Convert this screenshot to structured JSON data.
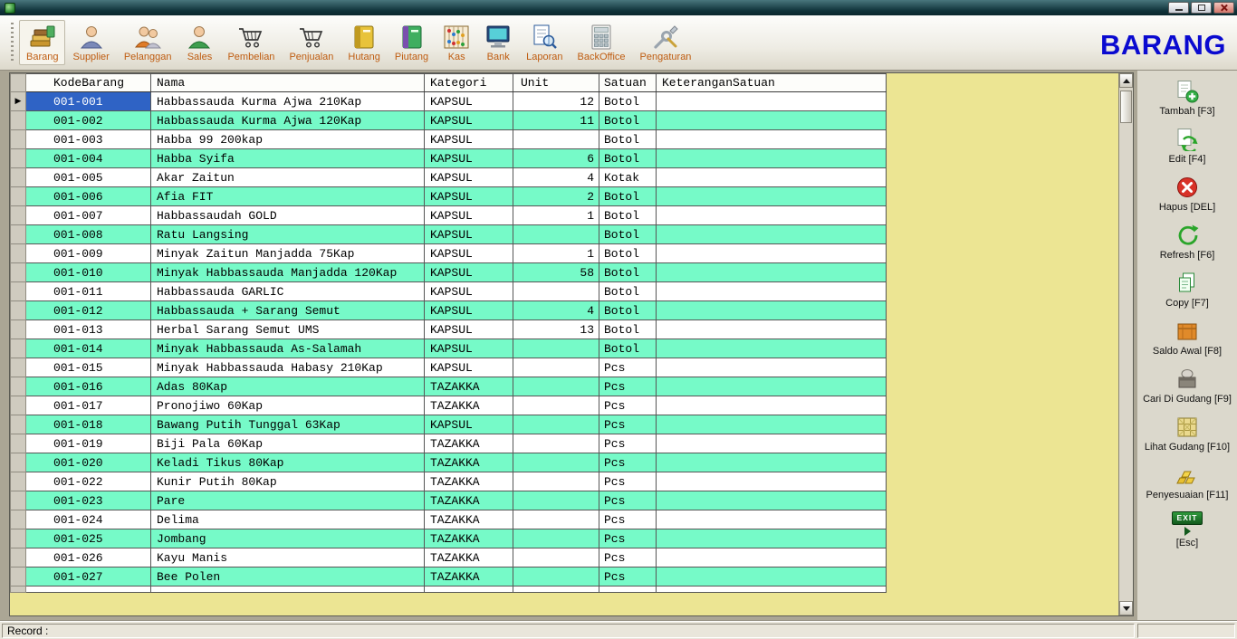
{
  "window": {
    "name": "inventory-application"
  },
  "header": {
    "brand": "BARANG"
  },
  "toolbar": {
    "items": [
      {
        "label": "Barang",
        "icon": "barang-icon"
      },
      {
        "label": "Supplier",
        "icon": "supplier-icon"
      },
      {
        "label": "Pelanggan",
        "icon": "pelanggan-icon"
      },
      {
        "label": "Sales",
        "icon": "sales-icon"
      },
      {
        "label": "Pembelian",
        "icon": "pembelian-cart-icon"
      },
      {
        "label": "Penjualan",
        "icon": "penjualan-cart-icon"
      },
      {
        "label": "Hutang",
        "icon": "hutang-book-icon"
      },
      {
        "label": "Piutang",
        "icon": "piutang-book-icon"
      },
      {
        "label": "Kas",
        "icon": "kas-abacus-icon"
      },
      {
        "label": "Bank",
        "icon": "bank-monitor-icon"
      },
      {
        "label": "Laporan",
        "icon": "laporan-report-icon"
      },
      {
        "label": "BackOffice",
        "icon": "backoffice-calculator-icon"
      },
      {
        "label": "Pengaturan",
        "icon": "pengaturan-tools-icon"
      }
    ]
  },
  "grid": {
    "columns": [
      "KodeBarang",
      "Nama",
      "Kategori",
      "Unit",
      "Satuan",
      "KeteranganSatuan"
    ],
    "rows": [
      {
        "pointer": "▶",
        "kode": "001-001",
        "nama": "Habbassauda Kurma Ajwa 210Kap",
        "kategori": "KAPSUL",
        "unit": "12",
        "satuan": "Botol",
        "keterangan": ""
      },
      {
        "pointer": "",
        "kode": "001-002",
        "nama": "Habbassauda Kurma Ajwa 120Kap",
        "kategori": "KAPSUL",
        "unit": "11",
        "satuan": "Botol",
        "keterangan": ""
      },
      {
        "pointer": "",
        "kode": "001-003",
        "nama": "Habba 99 200kap",
        "kategori": "KAPSUL",
        "unit": "",
        "satuan": "Botol",
        "keterangan": ""
      },
      {
        "pointer": "",
        "kode": "001-004",
        "nama": "Habba Syifa",
        "kategori": "KAPSUL",
        "unit": "6",
        "satuan": "Botol",
        "keterangan": ""
      },
      {
        "pointer": "",
        "kode": "001-005",
        "nama": "Akar Zaitun",
        "kategori": "KAPSUL",
        "unit": "4",
        "satuan": "Kotak",
        "keterangan": ""
      },
      {
        "pointer": "",
        "kode": "001-006",
        "nama": "Afia FIT",
        "kategori": "KAPSUL",
        "unit": "2",
        "satuan": "Botol",
        "keterangan": ""
      },
      {
        "pointer": "",
        "kode": "001-007",
        "nama": "Habbassaudah GOLD",
        "kategori": "KAPSUL",
        "unit": "1",
        "satuan": "Botol",
        "keterangan": ""
      },
      {
        "pointer": "",
        "kode": "001-008",
        "nama": "Ratu Langsing",
        "kategori": "KAPSUL",
        "unit": "",
        "satuan": "Botol",
        "keterangan": ""
      },
      {
        "pointer": "",
        "kode": "001-009",
        "nama": "Minyak Zaitun Manjadda 75Kap",
        "kategori": "KAPSUL",
        "unit": "1",
        "satuan": "Botol",
        "keterangan": ""
      },
      {
        "pointer": "",
        "kode": "001-010",
        "nama": "Minyak Habbassauda Manjadda 120Kap",
        "kategori": "KAPSUL",
        "unit": "58",
        "satuan": "Botol",
        "keterangan": ""
      },
      {
        "pointer": "",
        "kode": "001-011",
        "nama": "Habbassauda GARLIC",
        "kategori": "KAPSUL",
        "unit": "",
        "satuan": "Botol",
        "keterangan": ""
      },
      {
        "pointer": "",
        "kode": "001-012",
        "nama": "Habbassauda + Sarang Semut",
        "kategori": "KAPSUL",
        "unit": "4",
        "satuan": "Botol",
        "keterangan": ""
      },
      {
        "pointer": "",
        "kode": "001-013",
        "nama": "Herbal Sarang Semut UMS",
        "kategori": "KAPSUL",
        "unit": "13",
        "satuan": "Botol",
        "keterangan": ""
      },
      {
        "pointer": "",
        "kode": "001-014",
        "nama": "Minyak Habbassauda As-Salamah",
        "kategori": "KAPSUL",
        "unit": "",
        "satuan": "Botol",
        "keterangan": ""
      },
      {
        "pointer": "",
        "kode": "001-015",
        "nama": "Minyak Habbassauda Habasy 210Kap",
        "kategori": "KAPSUL",
        "unit": "",
        "satuan": "Pcs",
        "keterangan": ""
      },
      {
        "pointer": "",
        "kode": "001-016",
        "nama": "Adas 80Kap",
        "kategori": "TAZAKKA",
        "unit": "",
        "satuan": "Pcs",
        "keterangan": ""
      },
      {
        "pointer": "",
        "kode": "001-017",
        "nama": "Pronojiwo 60Kap",
        "kategori": "TAZAKKA",
        "unit": "",
        "satuan": "Pcs",
        "keterangan": ""
      },
      {
        "pointer": "",
        "kode": "001-018",
        "nama": "Bawang Putih Tunggal 63Kap",
        "kategori": "KAPSUL",
        "unit": "",
        "satuan": "Pcs",
        "keterangan": ""
      },
      {
        "pointer": "",
        "kode": "001-019",
        "nama": "Biji Pala 60Kap",
        "kategori": "TAZAKKA",
        "unit": "",
        "satuan": "Pcs",
        "keterangan": ""
      },
      {
        "pointer": "",
        "kode": "001-020",
        "nama": "Keladi Tikus 80Kap",
        "kategori": "TAZAKKA",
        "unit": "",
        "satuan": "Pcs",
        "keterangan": ""
      },
      {
        "pointer": "",
        "kode": "001-022",
        "nama": "Kunir Putih 80Kap",
        "kategori": "TAZAKKA",
        "unit": "",
        "satuan": "Pcs",
        "keterangan": ""
      },
      {
        "pointer": "",
        "kode": "001-023",
        "nama": "Pare",
        "kategori": "TAZAKKA",
        "unit": "",
        "satuan": "Pcs",
        "keterangan": ""
      },
      {
        "pointer": "",
        "kode": "001-024",
        "nama": "Delima",
        "kategori": "TAZAKKA",
        "unit": "",
        "satuan": "Pcs",
        "keterangan": ""
      },
      {
        "pointer": "",
        "kode": "001-025",
        "nama": "Jombang",
        "kategori": "TAZAKKA",
        "unit": "",
        "satuan": "Pcs",
        "keterangan": ""
      },
      {
        "pointer": "",
        "kode": "001-026",
        "nama": "Kayu Manis",
        "kategori": "TAZAKKA",
        "unit": "",
        "satuan": "Pcs",
        "keterangan": ""
      },
      {
        "pointer": "",
        "kode": "001-027",
        "nama": "Bee Polen",
        "kategori": "TAZAKKA",
        "unit": "",
        "satuan": "Pcs",
        "keterangan": ""
      }
    ]
  },
  "sidebar": {
    "buttons": [
      {
        "label": "Tambah [F3]",
        "icon": "tambah-add-icon"
      },
      {
        "label": "Edit [F4]",
        "icon": "edit-icon"
      },
      {
        "label": "Hapus [DEL]",
        "icon": "hapus-delete-icon"
      },
      {
        "label": "Refresh [F6]",
        "icon": "refresh-icon"
      },
      {
        "label": "Copy [F7]",
        "icon": "copy-icon"
      },
      {
        "label": "Saldo Awal [F8]",
        "icon": "saldo-awal-crate-icon"
      },
      {
        "label": "Cari Di Gudang [F9]",
        "icon": "cari-gudang-icon"
      },
      {
        "label": "Lihat Gudang [F10]",
        "icon": "lihat-gudang-icon"
      },
      {
        "label": "Penyesuaian [F11]",
        "icon": "penyesuaian-gold-icon"
      },
      {
        "label": "[Esc]",
        "icon": "exit-icon"
      }
    ],
    "exit_icon_text": "EXIT"
  },
  "statusbar": {
    "record_label": "Record :"
  },
  "colors": {
    "row_alt": "#76fac8",
    "selection": "#2f63c5",
    "grid_panel": "#ece593",
    "brand_blue": "#0a0ad0",
    "toolbar_label": "#bf5c10"
  }
}
